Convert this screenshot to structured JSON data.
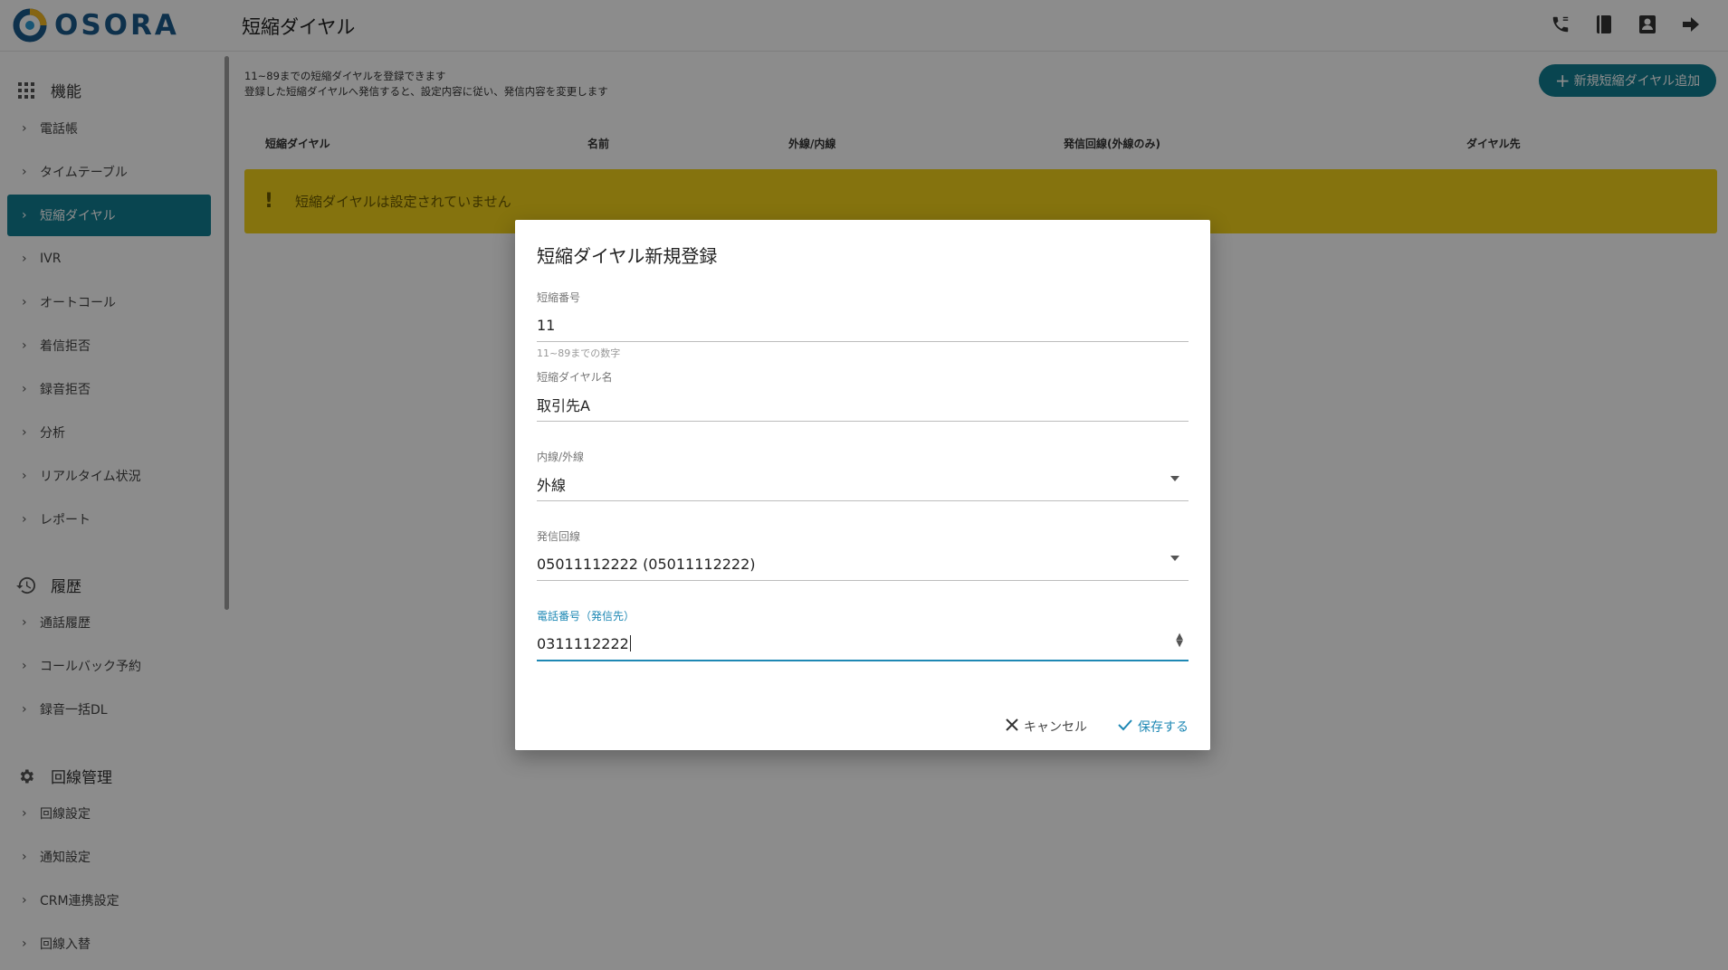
{
  "header": {
    "logo_text": "OSORA",
    "page_title": "短縮ダイヤル",
    "icons": [
      "phone-icon",
      "book-icon",
      "contact-icon",
      "logout-icon"
    ]
  },
  "sidebar": {
    "sections": [
      {
        "title": "機能",
        "icon": "apps-grid-icon",
        "items": [
          "電話帳",
          "タイムテーブル",
          "短縮ダイヤル",
          "IVR",
          "オートコール",
          "着信拒否",
          "録音拒否",
          "分析",
          "リアルタイム状況",
          "レポート"
        ]
      },
      {
        "title": "履歴",
        "icon": "history-icon",
        "items": [
          "通話履歴",
          "コールバック予約",
          "録音一括DL"
        ]
      },
      {
        "title": "回線管理",
        "icon": "gear-icon",
        "items": [
          "回線設定",
          "通知設定",
          "CRM連携設定",
          "回線入替"
        ]
      }
    ],
    "active_item": "短縮ダイヤル"
  },
  "main": {
    "description_line1": "11~89までの短縮ダイヤルを登録できます",
    "description_line2": "登録した短縮ダイヤルへ発信すると、設定内容に従い、発信内容を変更します",
    "add_button_label": "新規短縮ダイヤル追加",
    "table_headers": [
      "短縮ダイヤル",
      "名前",
      "外線/内線",
      "発信回線(外線のみ)",
      "ダイヤル先"
    ],
    "empty_message": "短縮ダイヤルは設定されていません"
  },
  "dialog": {
    "title": "短縮ダイヤル新規登録",
    "fields": {
      "short_number": {
        "label": "短縮番号",
        "value": "11",
        "hint": "11~89までの数字"
      },
      "name": {
        "label": "短縮ダイヤル名",
        "value": "取引先A"
      },
      "line_type": {
        "label": "内線/外線",
        "value": "外線"
      },
      "outgoing_line": {
        "label": "発信回線",
        "value": "05011112222 (05011112222)"
      },
      "phone_number": {
        "label": "電話番号（発信先）",
        "value": "0311112222"
      }
    },
    "cancel_label": "キャンセル",
    "save_label": "保存する"
  },
  "colors": {
    "brand_teal": "#127f93",
    "accent_blue": "#1e88b4",
    "warning_yellow": "#f3d21b",
    "logo_blue": "#1a5a8a",
    "logo_yellow": "#f2b824"
  }
}
